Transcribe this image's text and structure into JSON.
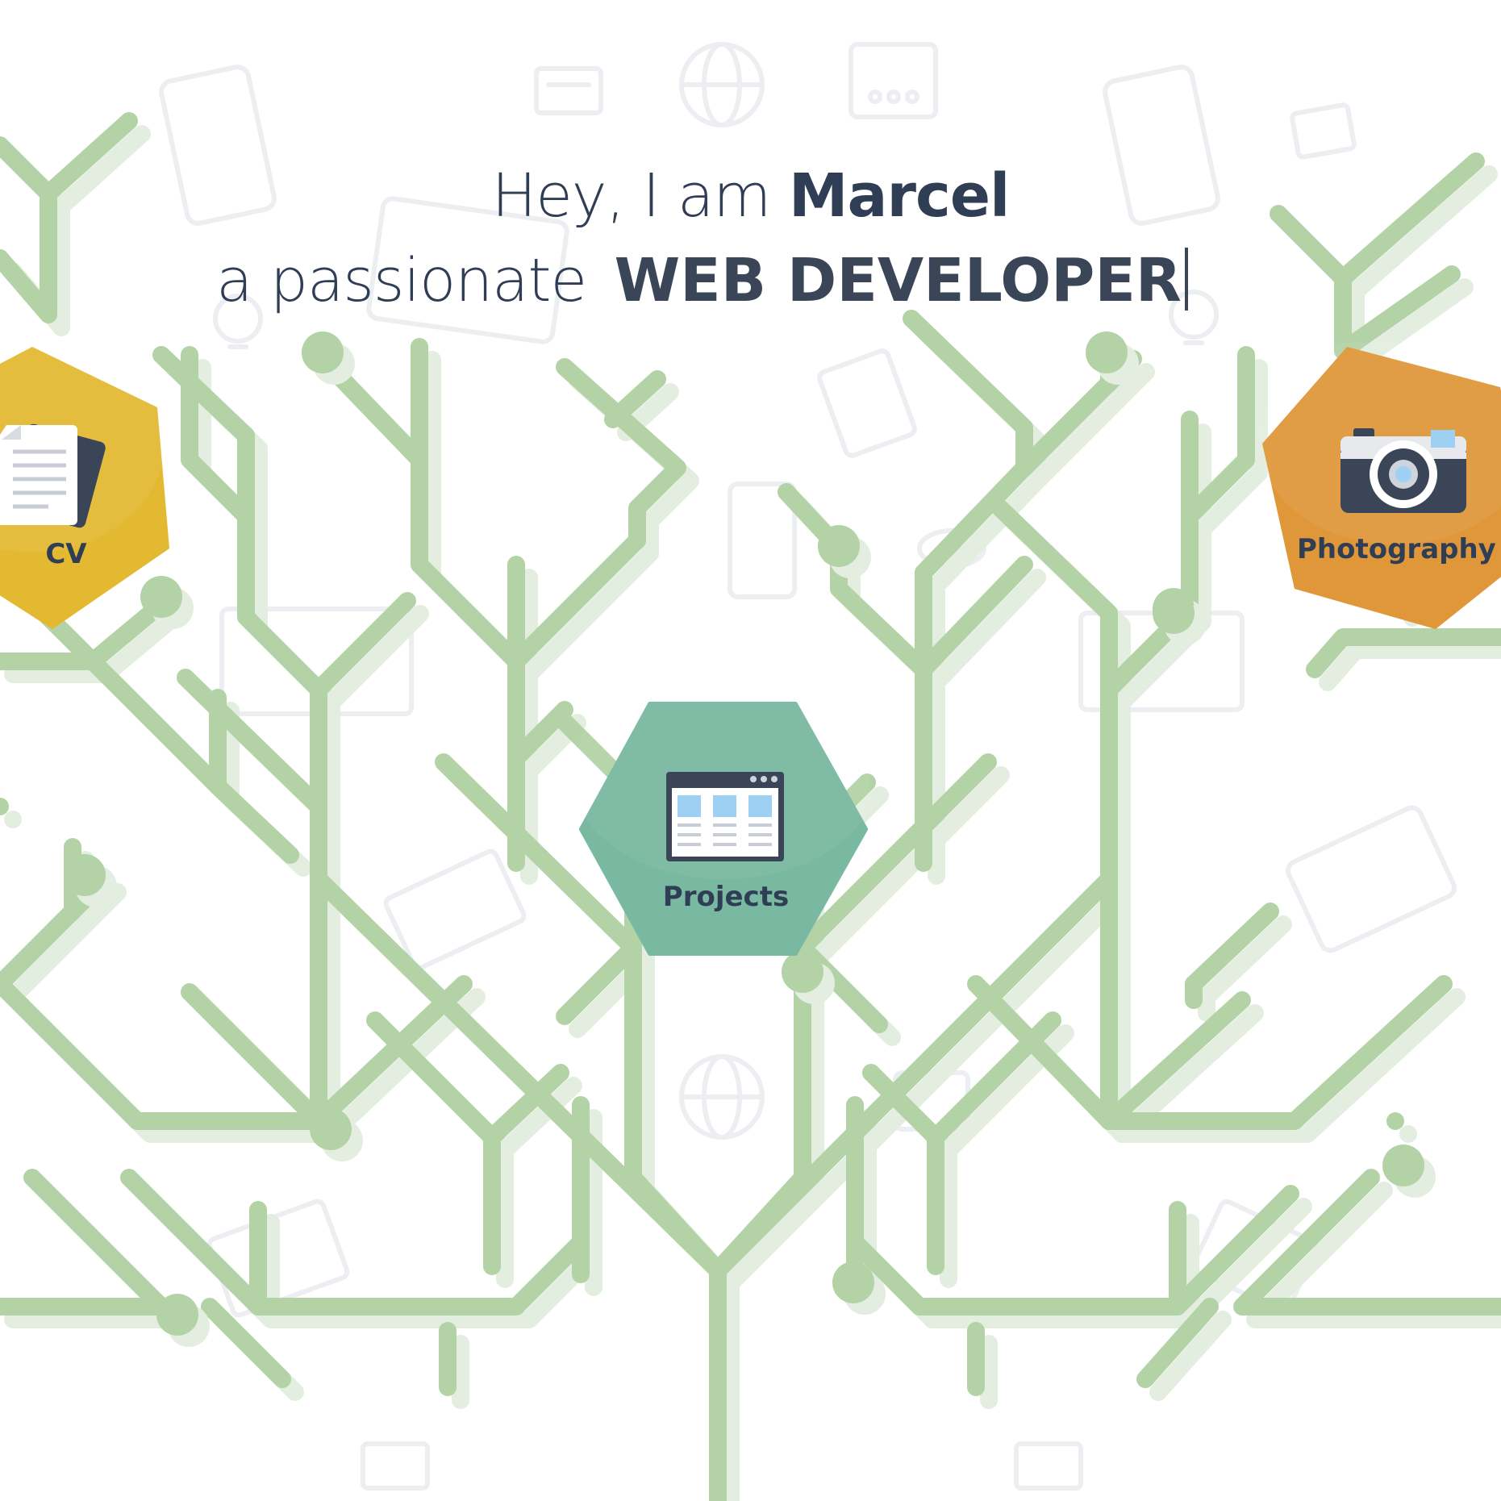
{
  "hero": {
    "greeting": "Hey, I am ",
    "name": "Marcel",
    "prefix": "a passionate",
    "role": "WEB DEVELOPER"
  },
  "nav": {
    "cv": {
      "label": "CV",
      "icon": "document-stack-icon",
      "color": "#e3b932"
    },
    "projects": {
      "label": "Projects",
      "icon": "browser-window-icon",
      "color": "#7ab9a1"
    },
    "photography": {
      "label": "Photography",
      "icon": "camera-icon",
      "color": "#e0973a"
    }
  },
  "colors": {
    "text": "#2f3e55",
    "branch": "#b3d3a7",
    "branch_shadow": "#e3eee0",
    "pattern": "#eef0f3"
  }
}
